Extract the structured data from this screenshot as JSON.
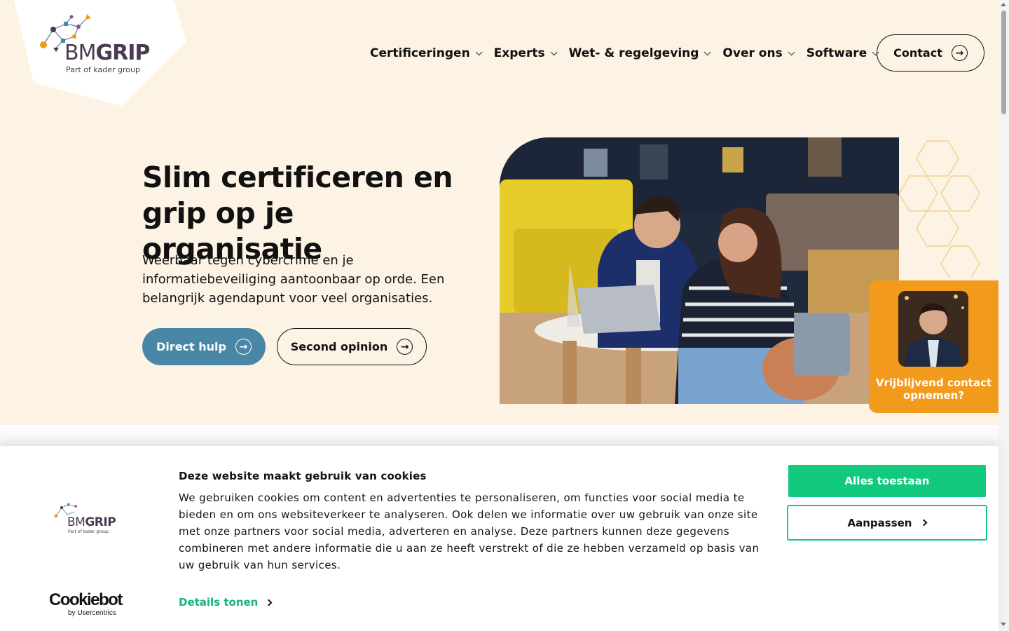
{
  "brand": {
    "logo_name": "BMGRIP",
    "logo_sub": "Part of kader group",
    "colors": {
      "hero_bg": "#fdf3e5",
      "accent_blue": "#4a86a6",
      "accent_orange": "#f29a1c",
      "cookie_green": "#12c97e",
      "logo_purple": "#4b3a52"
    }
  },
  "nav": {
    "items": [
      {
        "label": "Certificeringen",
        "icon": "chevron-down-icon"
      },
      {
        "label": "Experts",
        "icon": "chevron-down-icon"
      },
      {
        "label": "Wet- & regelgeving",
        "icon": "chevron-down-icon"
      },
      {
        "label": "Over ons",
        "icon": "chevron-down-icon"
      },
      {
        "label": "Software",
        "icon": "chevron-down-icon"
      }
    ],
    "contact_label": "Contact",
    "contact_icon": "arrow-right-circle-icon"
  },
  "hero": {
    "title": "Slim certificeren en grip op je organisatie",
    "text": "Weerbaar tegen cybercrime en je informatiebeveiliging aantoonbaar op orde. Een belangrijk agendapunt voor veel organisaties.",
    "primary_button": "Direct hulp",
    "secondary_button": "Second opinion"
  },
  "contact_card": {
    "label": "Vrijblijvend contact opnemen?"
  },
  "cookie_banner": {
    "title": "Deze website maakt gebruik van cookies",
    "body": "We gebruiken cookies om content en advertenties te personaliseren, om functies voor social media te bieden en om ons websiteverkeer te analyseren. Ook delen we informatie over uw gebruik van onze site met onze partners voor social media, adverteren en analyse. Deze partners kunnen deze gegevens combineren met andere informatie die u aan ze heeft verstrekt of die ze hebben verzameld op basis van uw gebruik van hun services.",
    "details_link": "Details tonen",
    "allow_all": "Alles toestaan",
    "customize": "Aanpassen",
    "provider_name": "Cookiebot",
    "provider_sub": "by Usercentrics"
  }
}
